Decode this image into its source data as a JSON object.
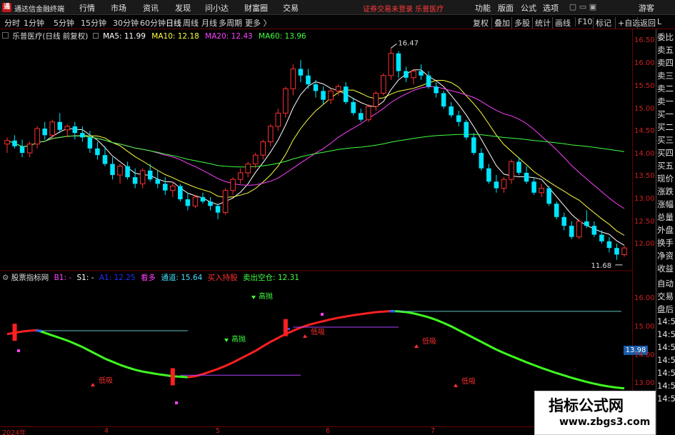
{
  "app": {
    "title": "通达信金融终端",
    "notice": "证券交易未登录",
    "stock_name": "乐普医疗",
    "guest": "游客"
  },
  "menu": [
    "行情",
    "市场",
    "资讯",
    "发现",
    "问小达",
    "财富圈",
    "交易"
  ],
  "top_right_menu": [
    "功能",
    "版面",
    "公式",
    "选项"
  ],
  "periods": [
    "分时",
    "1分钟",
    "5分钟",
    "15分钟",
    "30分钟",
    "60分钟",
    "日线",
    "周线",
    "月线",
    "多周期",
    "更多 〉"
  ],
  "active_period": "日线",
  "toolbar": [
    "复权",
    "叠加",
    "多股",
    "统计",
    "画线",
    "F10",
    "标记",
    "+自选",
    "返回"
  ],
  "colors": {
    "up": "#ff3030",
    "down": "#00e5ff",
    "ma5": "#ffffff",
    "ma10": "#ffff40",
    "ma20": "#ff40ff",
    "ma60": "#40ff40",
    "axis": "#cc2222"
  },
  "main_legend": {
    "title": "乐普医疗(日线 前复权)",
    "ma5": "MA5: 11.99",
    "ma10": "MA10: 12.18",
    "ma20": "MA20: 12.43",
    "ma60": "MA60: 13.96"
  },
  "main_axis": [
    "16.50",
    "16.00",
    "15.50",
    "15.00",
    "14.50",
    "14.00",
    "13.50",
    "13.00",
    "12.50",
    "12.00"
  ],
  "high_label": "16.47",
  "low_label": "11.68",
  "sub_legend": {
    "name": "股票指标网",
    "b1": "B1: -",
    "s1": "S1: -",
    "a1": "A1: 12.25",
    "kan": "看多",
    "tongdao": "通道: 15.64",
    "buy": "买入持股",
    "sell": "卖出空仓: 12.31"
  },
  "sub_axis": [
    "16.00",
    "15.00",
    "14.00",
    "13.00"
  ],
  "sub_axis_box": "13.98",
  "sub_labels": {
    "high": "高抛",
    "low": "低吸"
  },
  "right_panel": [
    "委比",
    "卖五",
    "卖四",
    "卖三",
    "卖二",
    "卖一",
    "买一",
    "买二",
    "买三",
    "买四",
    "买五",
    "现价",
    "涨跌",
    "涨幅",
    "总量",
    "外盘",
    "换手",
    "净资",
    "收益",
    "自动",
    "交易",
    "盘后",
    "14:5",
    "14:5",
    "14:5",
    "14:5",
    "14:5",
    "14:5",
    "14:5"
  ],
  "time_axis": [
    "2024年",
    "4",
    "5",
    "6",
    "7"
  ],
  "watermark": {
    "line1": "指标公式网",
    "line2": "www.zbgs3.com"
  },
  "chart_data": {
    "type": "candlestick",
    "ylim": [
      11.5,
      16.75
    ],
    "candles": [
      [
        14.3,
        14.45,
        14.1,
        14.38
      ],
      [
        14.38,
        14.5,
        14.2,
        14.25
      ],
      [
        14.25,
        14.4,
        14.0,
        14.1
      ],
      [
        14.1,
        14.35,
        14.0,
        14.3
      ],
      [
        14.3,
        14.7,
        14.2,
        14.65
      ],
      [
        14.65,
        14.8,
        14.4,
        14.5
      ],
      [
        14.5,
        14.85,
        14.4,
        14.8
      ],
      [
        14.8,
        15.0,
        14.55,
        14.62
      ],
      [
        14.62,
        14.75,
        14.45,
        14.7
      ],
      [
        14.7,
        14.8,
        14.4,
        14.55
      ],
      [
        14.55,
        14.7,
        14.35,
        14.45
      ],
      [
        14.45,
        14.6,
        14.1,
        14.2
      ],
      [
        14.2,
        14.35,
        13.95,
        14.05
      ],
      [
        14.05,
        14.25,
        13.8,
        13.85
      ],
      [
        13.85,
        14.0,
        13.5,
        13.6
      ],
      [
        13.6,
        13.85,
        13.4,
        13.8
      ],
      [
        13.8,
        13.9,
        13.5,
        13.55
      ],
      [
        13.55,
        13.75,
        13.3,
        13.4
      ],
      [
        13.4,
        13.75,
        13.3,
        13.7
      ],
      [
        13.7,
        13.85,
        13.45,
        13.5
      ],
      [
        13.5,
        13.7,
        13.3,
        13.4
      ],
      [
        13.4,
        13.55,
        13.15,
        13.25
      ],
      [
        13.25,
        13.45,
        13.1,
        13.35
      ],
      [
        13.35,
        13.4,
        13.0,
        13.05
      ],
      [
        13.05,
        13.2,
        12.8,
        12.9
      ],
      [
        12.9,
        13.15,
        12.85,
        13.1
      ],
      [
        13.1,
        13.2,
        12.95,
        13.0
      ],
      [
        13.0,
        13.1,
        12.8,
        12.9
      ],
      [
        12.9,
        12.95,
        12.6,
        12.75
      ],
      [
        12.75,
        13.3,
        12.7,
        13.25
      ],
      [
        13.25,
        13.55,
        13.15,
        13.5
      ],
      [
        13.5,
        13.75,
        13.4,
        13.65
      ],
      [
        13.65,
        13.9,
        13.55,
        13.85
      ],
      [
        13.85,
        14.1,
        13.75,
        14.05
      ],
      [
        14.05,
        14.4,
        13.95,
        14.35
      ],
      [
        14.35,
        14.75,
        14.25,
        14.7
      ],
      [
        14.7,
        15.1,
        14.6,
        15.0
      ],
      [
        15.0,
        15.6,
        14.9,
        15.55
      ],
      [
        15.55,
        16.1,
        15.4,
        16.0
      ],
      [
        16.0,
        16.2,
        15.7,
        15.85
      ],
      [
        15.85,
        16.0,
        15.55,
        15.65
      ],
      [
        15.65,
        15.75,
        15.35,
        15.5
      ],
      [
        15.5,
        15.6,
        15.2,
        15.3
      ],
      [
        15.3,
        15.55,
        15.2,
        15.5
      ],
      [
        15.5,
        15.65,
        15.4,
        15.6
      ],
      [
        15.6,
        15.7,
        15.2,
        15.25
      ],
      [
        15.25,
        15.35,
        14.95,
        15.0
      ],
      [
        15.0,
        15.1,
        14.8,
        14.85
      ],
      [
        14.85,
        15.2,
        14.8,
        15.15
      ],
      [
        15.15,
        15.5,
        15.05,
        15.45
      ],
      [
        15.45,
        15.9,
        15.4,
        15.85
      ],
      [
        15.85,
        16.47,
        15.75,
        16.35
      ],
      [
        16.35,
        16.4,
        15.8,
        15.95
      ],
      [
        15.95,
        16.05,
        15.7,
        15.8
      ],
      [
        15.8,
        16.0,
        15.65,
        15.95
      ],
      [
        15.95,
        16.1,
        15.75,
        15.85
      ],
      [
        15.85,
        15.95,
        15.55,
        15.6
      ],
      [
        15.6,
        15.7,
        15.35,
        15.45
      ],
      [
        15.45,
        15.5,
        15.1,
        15.15
      ],
      [
        15.15,
        15.25,
        14.9,
        14.95
      ],
      [
        14.95,
        15.05,
        14.7,
        14.8
      ],
      [
        14.8,
        14.85,
        14.4,
        14.45
      ],
      [
        14.45,
        14.55,
        14.05,
        14.1
      ],
      [
        14.1,
        14.2,
        13.7,
        13.75
      ],
      [
        13.75,
        13.85,
        13.4,
        13.45
      ],
      [
        13.45,
        13.6,
        13.2,
        13.3
      ],
      [
        13.3,
        13.55,
        13.2,
        13.5
      ],
      [
        13.5,
        13.95,
        13.4,
        13.9
      ],
      [
        13.9,
        14.0,
        13.6,
        13.65
      ],
      [
        13.65,
        13.8,
        13.4,
        13.45
      ],
      [
        13.45,
        13.55,
        13.15,
        13.2
      ],
      [
        13.2,
        13.4,
        13.1,
        13.3
      ],
      [
        13.3,
        13.35,
        12.9,
        12.95
      ],
      [
        12.95,
        13.0,
        12.6,
        12.65
      ],
      [
        12.65,
        12.75,
        12.35,
        12.45
      ],
      [
        12.45,
        12.55,
        12.15,
        12.2
      ],
      [
        12.2,
        12.6,
        12.15,
        12.55
      ],
      [
        12.55,
        12.8,
        12.4,
        12.45
      ],
      [
        12.45,
        12.55,
        12.2,
        12.25
      ],
      [
        12.25,
        12.35,
        12.05,
        12.1
      ],
      [
        12.1,
        12.2,
        11.85,
        11.95
      ],
      [
        11.95,
        12.05,
        11.68,
        11.8
      ],
      [
        11.8,
        12.0,
        11.75,
        11.95
      ]
    ],
    "sub_channel": {
      "ylim": [
        12.4,
        16.6
      ],
      "values": [
        14.95,
        15.0,
        15.05,
        15.08,
        15.1,
        15.0,
        14.9,
        14.8,
        14.7,
        14.58,
        14.45,
        14.3,
        14.15,
        14.0,
        13.88,
        13.76,
        13.66,
        13.57,
        13.5,
        13.45,
        13.4,
        13.36,
        13.32,
        13.3,
        13.28,
        13.32,
        13.4,
        13.5,
        13.6,
        13.72,
        13.85,
        14.0,
        14.15,
        14.3,
        14.48,
        14.65,
        14.8,
        14.95,
        15.08,
        15.2,
        15.3,
        15.38,
        15.45,
        15.52,
        15.58,
        15.63,
        15.68,
        15.72,
        15.76,
        15.8,
        15.82,
        15.84,
        15.83,
        15.8,
        15.75,
        15.68,
        15.6,
        15.5,
        15.38,
        15.25,
        15.1,
        14.95,
        14.8,
        14.65,
        14.5,
        14.35,
        14.22,
        14.1,
        13.98,
        13.86,
        13.75,
        13.64,
        13.54,
        13.44,
        13.35,
        13.26,
        13.18,
        13.1,
        13.03,
        12.97,
        12.92,
        12.88,
        12.85
      ]
    }
  }
}
